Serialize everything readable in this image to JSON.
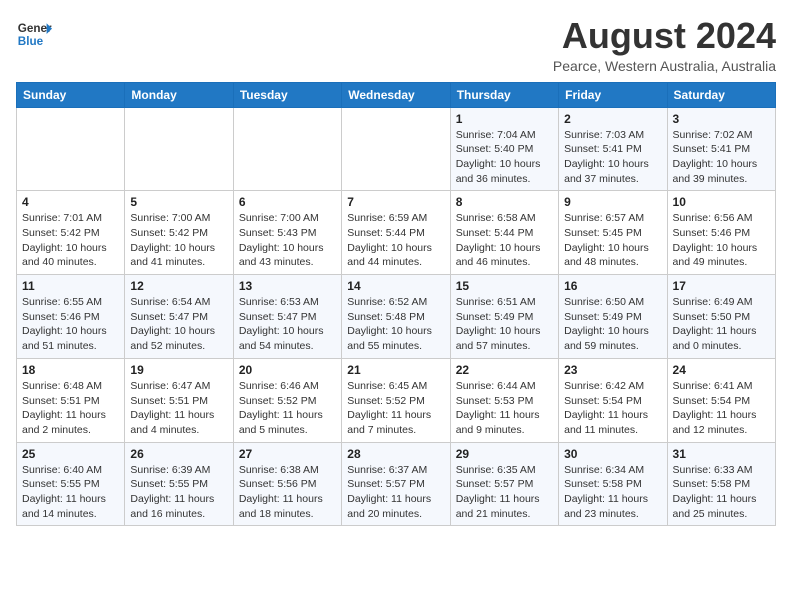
{
  "header": {
    "logo_line1": "General",
    "logo_line2": "Blue",
    "month_year": "August 2024",
    "location": "Pearce, Western Australia, Australia"
  },
  "days_of_week": [
    "Sunday",
    "Monday",
    "Tuesday",
    "Wednesday",
    "Thursday",
    "Friday",
    "Saturday"
  ],
  "weeks": [
    [
      {
        "day": "",
        "info": ""
      },
      {
        "day": "",
        "info": ""
      },
      {
        "day": "",
        "info": ""
      },
      {
        "day": "",
        "info": ""
      },
      {
        "day": "1",
        "info": "Sunrise: 7:04 AM\nSunset: 5:40 PM\nDaylight: 10 hours\nand 36 minutes."
      },
      {
        "day": "2",
        "info": "Sunrise: 7:03 AM\nSunset: 5:41 PM\nDaylight: 10 hours\nand 37 minutes."
      },
      {
        "day": "3",
        "info": "Sunrise: 7:02 AM\nSunset: 5:41 PM\nDaylight: 10 hours\nand 39 minutes."
      }
    ],
    [
      {
        "day": "4",
        "info": "Sunrise: 7:01 AM\nSunset: 5:42 PM\nDaylight: 10 hours\nand 40 minutes."
      },
      {
        "day": "5",
        "info": "Sunrise: 7:00 AM\nSunset: 5:42 PM\nDaylight: 10 hours\nand 41 minutes."
      },
      {
        "day": "6",
        "info": "Sunrise: 7:00 AM\nSunset: 5:43 PM\nDaylight: 10 hours\nand 43 minutes."
      },
      {
        "day": "7",
        "info": "Sunrise: 6:59 AM\nSunset: 5:44 PM\nDaylight: 10 hours\nand 44 minutes."
      },
      {
        "day": "8",
        "info": "Sunrise: 6:58 AM\nSunset: 5:44 PM\nDaylight: 10 hours\nand 46 minutes."
      },
      {
        "day": "9",
        "info": "Sunrise: 6:57 AM\nSunset: 5:45 PM\nDaylight: 10 hours\nand 48 minutes."
      },
      {
        "day": "10",
        "info": "Sunrise: 6:56 AM\nSunset: 5:46 PM\nDaylight: 10 hours\nand 49 minutes."
      }
    ],
    [
      {
        "day": "11",
        "info": "Sunrise: 6:55 AM\nSunset: 5:46 PM\nDaylight: 10 hours\nand 51 minutes."
      },
      {
        "day": "12",
        "info": "Sunrise: 6:54 AM\nSunset: 5:47 PM\nDaylight: 10 hours\nand 52 minutes."
      },
      {
        "day": "13",
        "info": "Sunrise: 6:53 AM\nSunset: 5:47 PM\nDaylight: 10 hours\nand 54 minutes."
      },
      {
        "day": "14",
        "info": "Sunrise: 6:52 AM\nSunset: 5:48 PM\nDaylight: 10 hours\nand 55 minutes."
      },
      {
        "day": "15",
        "info": "Sunrise: 6:51 AM\nSunset: 5:49 PM\nDaylight: 10 hours\nand 57 minutes."
      },
      {
        "day": "16",
        "info": "Sunrise: 6:50 AM\nSunset: 5:49 PM\nDaylight: 10 hours\nand 59 minutes."
      },
      {
        "day": "17",
        "info": "Sunrise: 6:49 AM\nSunset: 5:50 PM\nDaylight: 11 hours\nand 0 minutes."
      }
    ],
    [
      {
        "day": "18",
        "info": "Sunrise: 6:48 AM\nSunset: 5:51 PM\nDaylight: 11 hours\nand 2 minutes."
      },
      {
        "day": "19",
        "info": "Sunrise: 6:47 AM\nSunset: 5:51 PM\nDaylight: 11 hours\nand 4 minutes."
      },
      {
        "day": "20",
        "info": "Sunrise: 6:46 AM\nSunset: 5:52 PM\nDaylight: 11 hours\nand 5 minutes."
      },
      {
        "day": "21",
        "info": "Sunrise: 6:45 AM\nSunset: 5:52 PM\nDaylight: 11 hours\nand 7 minutes."
      },
      {
        "day": "22",
        "info": "Sunrise: 6:44 AM\nSunset: 5:53 PM\nDaylight: 11 hours\nand 9 minutes."
      },
      {
        "day": "23",
        "info": "Sunrise: 6:42 AM\nSunset: 5:54 PM\nDaylight: 11 hours\nand 11 minutes."
      },
      {
        "day": "24",
        "info": "Sunrise: 6:41 AM\nSunset: 5:54 PM\nDaylight: 11 hours\nand 12 minutes."
      }
    ],
    [
      {
        "day": "25",
        "info": "Sunrise: 6:40 AM\nSunset: 5:55 PM\nDaylight: 11 hours\nand 14 minutes."
      },
      {
        "day": "26",
        "info": "Sunrise: 6:39 AM\nSunset: 5:55 PM\nDaylight: 11 hours\nand 16 minutes."
      },
      {
        "day": "27",
        "info": "Sunrise: 6:38 AM\nSunset: 5:56 PM\nDaylight: 11 hours\nand 18 minutes."
      },
      {
        "day": "28",
        "info": "Sunrise: 6:37 AM\nSunset: 5:57 PM\nDaylight: 11 hours\nand 20 minutes."
      },
      {
        "day": "29",
        "info": "Sunrise: 6:35 AM\nSunset: 5:57 PM\nDaylight: 11 hours\nand 21 minutes."
      },
      {
        "day": "30",
        "info": "Sunrise: 6:34 AM\nSunset: 5:58 PM\nDaylight: 11 hours\nand 23 minutes."
      },
      {
        "day": "31",
        "info": "Sunrise: 6:33 AM\nSunset: 5:58 PM\nDaylight: 11 hours\nand 25 minutes."
      }
    ]
  ]
}
